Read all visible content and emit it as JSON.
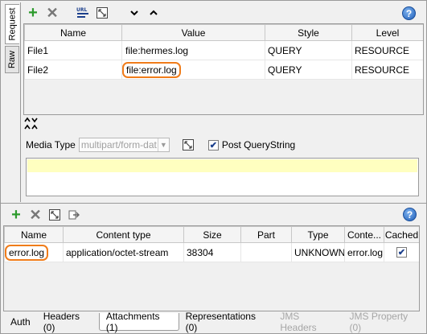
{
  "side_tabs": [
    {
      "label": "Request",
      "active": true
    },
    {
      "label": "Raw",
      "active": false
    }
  ],
  "toolbar_top": {
    "icons": [
      "add-icon",
      "remove-icon",
      "url-params-icon",
      "expand-icon",
      "move-down-icon",
      "move-up-icon"
    ],
    "help": "?"
  },
  "params_table": {
    "columns": [
      "Name",
      "Value",
      "Style",
      "Level"
    ],
    "rows": [
      {
        "name": "File1",
        "value": "file:hermes.log",
        "style": "QUERY",
        "level": "RESOURCE"
      },
      {
        "name": "File2",
        "value": "file:error.log",
        "style": "QUERY",
        "level": "RESOURCE"
      }
    ]
  },
  "media": {
    "label": "Media Type",
    "value": "multipart/form-data",
    "post_querystring_label": "Post QueryString",
    "post_querystring_checked": true,
    "check_glyph": "✔"
  },
  "toolbar_bottom": {
    "icons": [
      "add-icon",
      "remove-icon",
      "expand-icon",
      "export-icon"
    ],
    "help": "?"
  },
  "attachments_table": {
    "columns": [
      "Name",
      "Content type",
      "Size",
      "Part",
      "Type",
      "Conte...",
      "Cached"
    ],
    "rows": [
      {
        "name": "error.log",
        "content_type": "application/octet-stream",
        "size": "38304",
        "part": "",
        "type": "UNKNOWN",
        "content": "error.log",
        "cached": true
      }
    ]
  },
  "bottom_tabs": [
    {
      "label": "Auth",
      "state": "normal"
    },
    {
      "label": "Headers (0)",
      "state": "normal"
    },
    {
      "label": "Attachments (1)",
      "state": "active"
    },
    {
      "label": "Representations (0)",
      "state": "normal"
    },
    {
      "label": "JMS Headers",
      "state": "disabled"
    },
    {
      "label": "JMS Property (0)",
      "state": "disabled"
    }
  ],
  "colors": {
    "highlight": "#f07c1a",
    "yellow": "#ffffc0",
    "add_green": "#2b9a2b"
  }
}
